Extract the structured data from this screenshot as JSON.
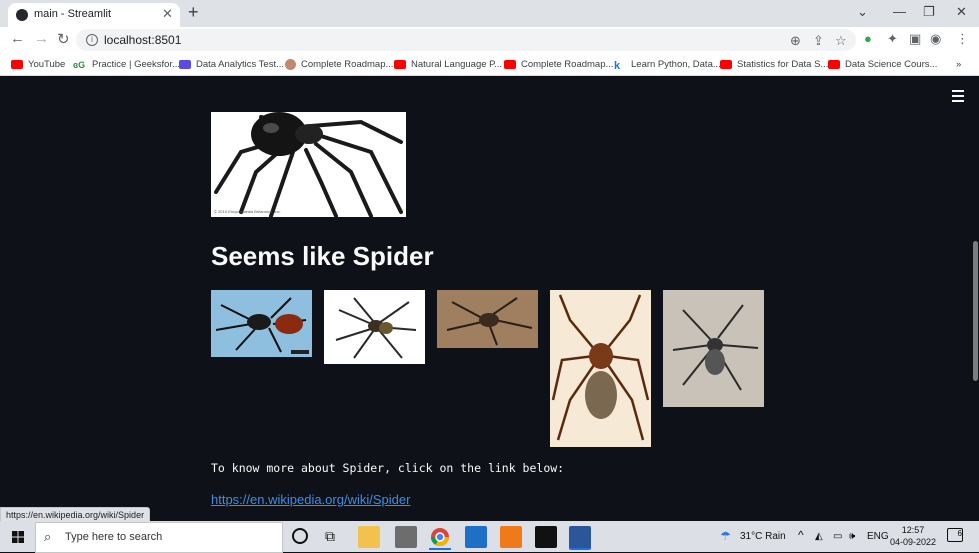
{
  "browser": {
    "tab_title": "main - Streamlit",
    "url": "localhost:8501",
    "status_url": "https://en.wikipedia.org/wiki/Spider"
  },
  "bookmarks": [
    {
      "label": "YouTube",
      "icon": "youtube-icon"
    },
    {
      "label": "Practice | Geeksfor...",
      "icon": "geeksforgeeks-icon"
    },
    {
      "label": "Data Analytics Test...",
      "icon": "r-icon"
    },
    {
      "label": "Complete Roadmap...",
      "icon": "avatar-icon"
    },
    {
      "label": "Natural Language P...",
      "icon": "youtube-icon"
    },
    {
      "label": "Complete Roadmap...",
      "icon": "youtube-icon"
    },
    {
      "label": "Learn Python, Data...",
      "icon": "k-icon"
    },
    {
      "label": "Statistics for Data S...",
      "icon": "youtube-icon"
    },
    {
      "label": "Data Science Cours...",
      "icon": "youtube-icon"
    }
  ],
  "main": {
    "heading": "Seems like Spider",
    "paragraph": "To know more about Spider, click on the link below:",
    "link": "https://en.wikipedia.org/wiki/Spider",
    "image_caption": "© 2010 Encyclopædia Britannica, Inc."
  },
  "taskbar": {
    "search_placeholder": "Type here to search",
    "weather": "31°C  Rain",
    "lang": "ENG",
    "time": "12:57",
    "date": "04-09-2022",
    "notif_count": "6"
  },
  "colors": {
    "page_bg": "#0e1117",
    "link": "#3b8eea"
  }
}
